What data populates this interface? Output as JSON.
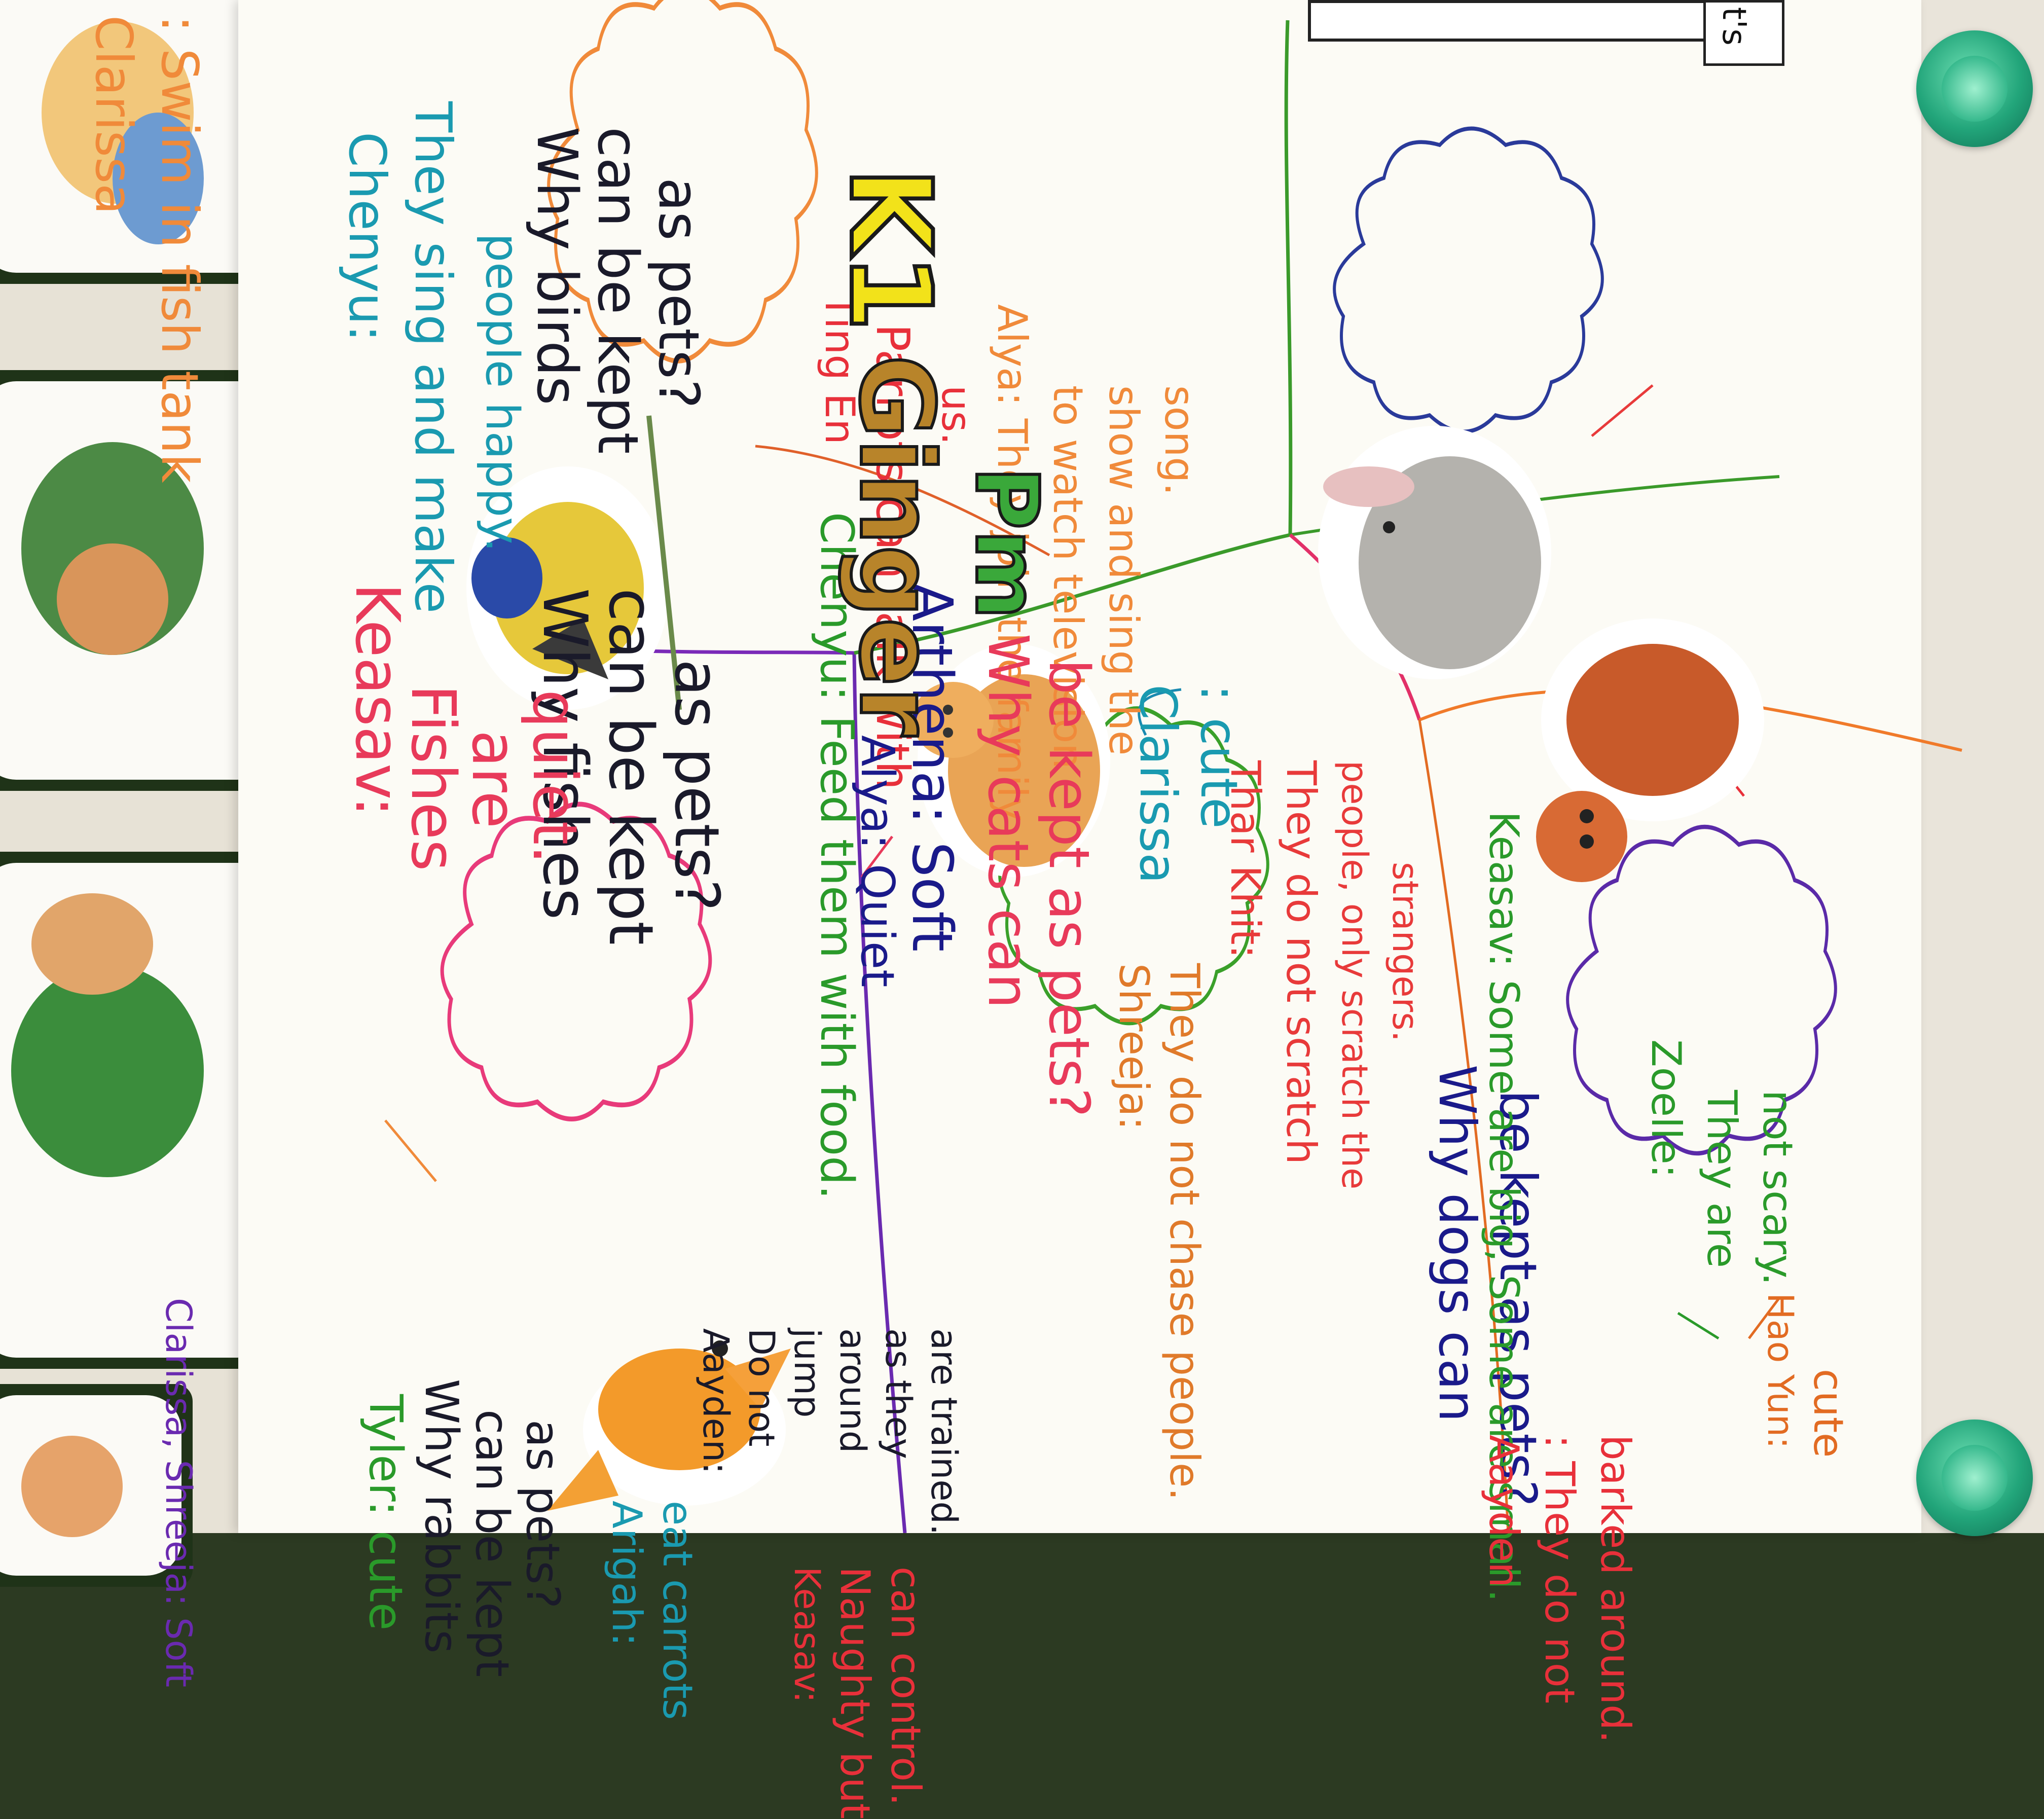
{
  "poster": {
    "class_label": "K1",
    "class_name_line1": "Ginger",
    "class_name_line2": "Pm",
    "strip_text": "t's"
  },
  "fish": {
    "question_line1": "Why fishes",
    "question_line2": "can be kept",
    "question_line3": "as pets?",
    "clarissa_name": "Clarissa",
    "clarissa_text": ": Swim in fish tank",
    "keasav_name": "Keasav:",
    "keasav_line1": "Fishes",
    "keasav_line2": "are",
    "keasav_line3": "quiet.",
    "chenyu_text": "Chenyu: Feed them with food."
  },
  "birds": {
    "question_line1": "Why birds",
    "question_line2": "can be kept",
    "question_line3": "as pets?",
    "chenyu_name": "Chenyu:",
    "chenyu_line1": "They sing and make",
    "chenyu_line2": "people happy.",
    "tingen_name": "Ting En",
    "tingen_line1": ": Parrots can talk with",
    "tingen_line2": "us.",
    "alya_line1": "Alya: They join the family",
    "alya_line2": "to watch television",
    "alya_line3": "show and sing the",
    "alya_line4": "song."
  },
  "cats": {
    "question_line1": "Why cats can",
    "question_line2": "be kept as pets?",
    "arthena_text": "Arthena: Soft",
    "alya_text": "Alya: Quiet",
    "clarissa_line1": "Clarissa",
    "clarissa_line2": ": cute",
    "shreeja_name": "Shreeja:",
    "shreeja_text": "They do not chase people.",
    "tharkhit_name": "Thar Khit:",
    "tharkhit_line1": "They do not scratch",
    "tharkhit_line2": "people, only scratch the",
    "tharkhit_line3": "strangers."
  },
  "rabbits": {
    "header_text": "Clarissa, Shreeja: Soft",
    "question_line1": "Why rabbits",
    "question_line2": "can be kept",
    "question_line3": "as pets?",
    "tyler_text": "Tyler: cute",
    "arigah_line1": "Arigah:",
    "arigah_line2": "eat carrots",
    "aayden_line1": "Aayden:",
    "aayden_line2": "Do not",
    "aayden_line3": "jump",
    "aayden_line4": "around",
    "aayden_line5": "as they",
    "aayden_line6": "are trained.",
    "keasav_line1": "Keasav:",
    "keasav_line2": "Naughty but",
    "keasav_line3": "can control."
  },
  "dogs": {
    "question_line1": "Why dogs can",
    "question_line2": "be kept as pets?",
    "keasav_text": "Keasav: Some are big, Some are small.",
    "aayden_name": "Aayden",
    "aayden_line1": ": They do not",
    "aayden_line2": "barked around.",
    "zoelle_name": "Zoelle:",
    "zoelle_line1": "They are",
    "zoelle_line2": "not scary.",
    "haoyun_name": "Hao Yun:",
    "haoyun_text": "cute"
  }
}
